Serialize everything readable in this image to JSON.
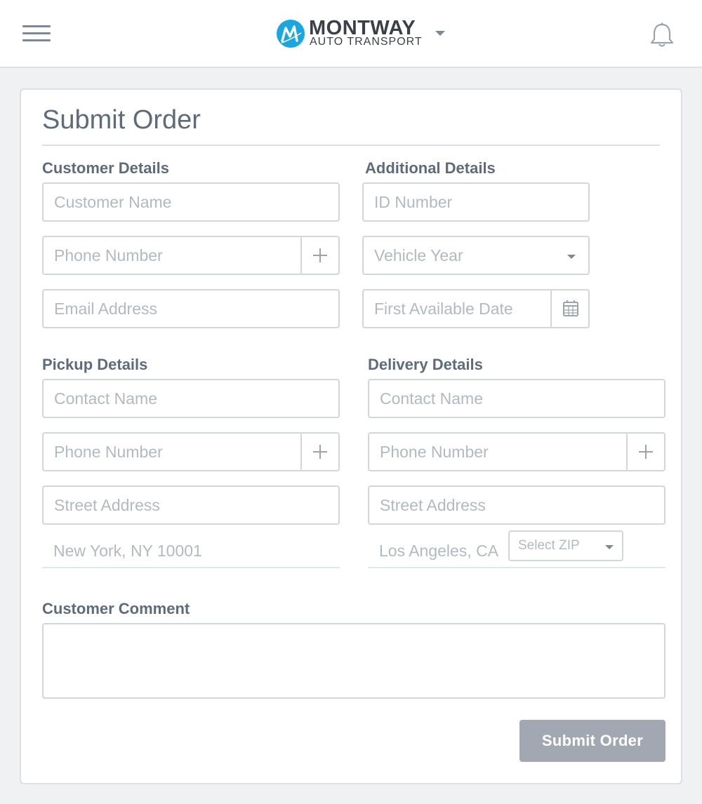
{
  "header": {
    "brand_name": "MONTWAY",
    "brand_sub": "AUTO TRANSPORT",
    "icons": {
      "menu": "hamburger-icon",
      "logo": "montway-logo-icon",
      "notifications": "bell-icon"
    },
    "accent_color": "#1aa7e0"
  },
  "form": {
    "title": "Submit Order",
    "customer": {
      "label": "Customer Details",
      "name_placeholder": "Customer Name",
      "phone_placeholder": "Phone Number",
      "email_placeholder": "Email Address"
    },
    "additional": {
      "label": "Additional Details",
      "id_placeholder": "ID Number",
      "vehicle_year_placeholder": "Vehicle Year",
      "first_date_placeholder": "First Available Date"
    },
    "pickup": {
      "label": "Pickup Details",
      "contact_placeholder": "Contact Name",
      "phone_placeholder": "Phone Number",
      "street_placeholder": "Street Address",
      "city_state_zip": "New York, NY 10001"
    },
    "delivery": {
      "label": "Delivery Details",
      "contact_placeholder": "Contact Name",
      "phone_placeholder": "Phone Number",
      "street_placeholder": "Street Address",
      "city_state": "Los Angeles, CA",
      "zip_placeholder": "Select ZIP"
    },
    "comment": {
      "label": "Customer Comment",
      "value": ""
    },
    "submit_label": "Submit Order"
  }
}
